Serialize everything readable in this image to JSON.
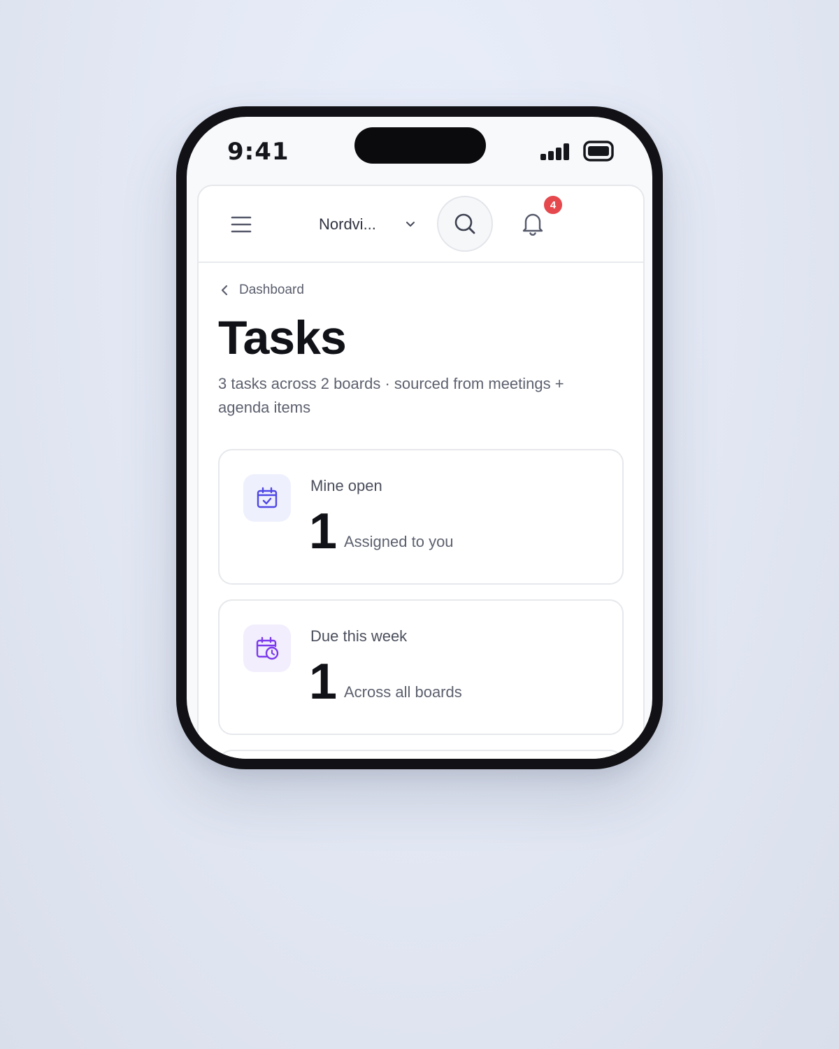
{
  "status_bar": {
    "time": "9:41"
  },
  "header": {
    "org_name": "Nordvi...",
    "notifications_count": "4",
    "icons": [
      "menu-icon",
      "chevron-down-icon",
      "search-icon",
      "bell-icon"
    ]
  },
  "breadcrumb": {
    "label": "Dashboard"
  },
  "page": {
    "title": "Tasks",
    "subtitle": "3 tasks across 2 boards · sourced from meetings + agenda items"
  },
  "stats": [
    {
      "label": "Mine open",
      "value": "1",
      "description": "Assigned to you",
      "icon": "calendar-check-icon",
      "icon_color": "#4f46e5",
      "icon_bg": "#eef0fd"
    },
    {
      "label": "Due this week",
      "value": "1",
      "description": "Across all boards",
      "icon": "calendar-clock-icon",
      "icon_color": "#7c3aed",
      "icon_bg": "#f2eefd"
    }
  ],
  "colors": {
    "badge": "#e5484d",
    "title": "#111217",
    "muted_text": "#5d616e"
  }
}
